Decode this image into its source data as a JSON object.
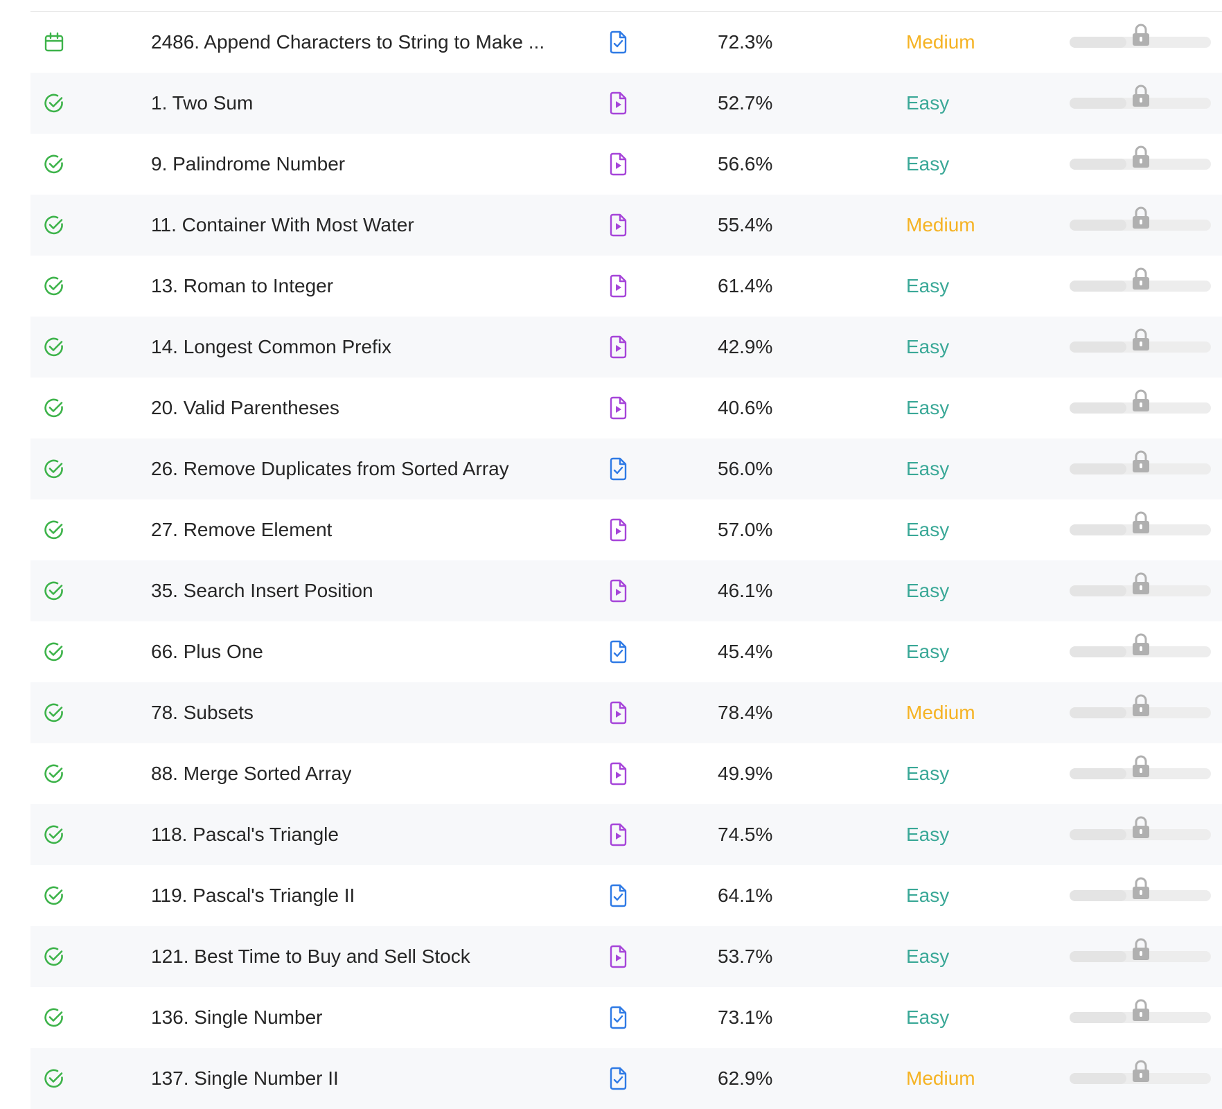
{
  "colors": {
    "easy": "#3aa897",
    "medium": "#f5b324",
    "hard": "#ef4743",
    "solved": "#3db34a",
    "daily": "#3db34a",
    "video_solution": "#a645d9",
    "article_solution": "#2f7ae5",
    "lock": "#b0b0b0"
  },
  "problems": [
    {
      "status_icon": "calendar-icon",
      "title": "2486. Append Characters to String to Make ...",
      "solution_icon": "article-solution-icon",
      "acceptance": "72.3%",
      "difficulty": "Medium",
      "frequency_locked": true,
      "frequency_fill": 0.4
    },
    {
      "status_icon": "solved-check-icon",
      "title": "1. Two Sum",
      "solution_icon": "video-solution-icon",
      "acceptance": "52.7%",
      "difficulty": "Easy",
      "frequency_locked": true,
      "frequency_fill": 0.4
    },
    {
      "status_icon": "solved-check-icon",
      "title": "9. Palindrome Number",
      "solution_icon": "video-solution-icon",
      "acceptance": "56.6%",
      "difficulty": "Easy",
      "frequency_locked": true,
      "frequency_fill": 0.4
    },
    {
      "status_icon": "solved-check-icon",
      "title": "11. Container With Most Water",
      "solution_icon": "video-solution-icon",
      "acceptance": "55.4%",
      "difficulty": "Medium",
      "frequency_locked": true,
      "frequency_fill": 0.4
    },
    {
      "status_icon": "solved-check-icon",
      "title": "13. Roman to Integer",
      "solution_icon": "video-solution-icon",
      "acceptance": "61.4%",
      "difficulty": "Easy",
      "frequency_locked": true,
      "frequency_fill": 0.4
    },
    {
      "status_icon": "solved-check-icon",
      "title": "14. Longest Common Prefix",
      "solution_icon": "video-solution-icon",
      "acceptance": "42.9%",
      "difficulty": "Easy",
      "frequency_locked": true,
      "frequency_fill": 0.4
    },
    {
      "status_icon": "solved-check-icon",
      "title": "20. Valid Parentheses",
      "solution_icon": "video-solution-icon",
      "acceptance": "40.6%",
      "difficulty": "Easy",
      "frequency_locked": true,
      "frequency_fill": 0.4
    },
    {
      "status_icon": "solved-check-icon",
      "title": "26. Remove Duplicates from Sorted Array",
      "solution_icon": "article-solution-icon",
      "acceptance": "56.0%",
      "difficulty": "Easy",
      "frequency_locked": true,
      "frequency_fill": 0.4
    },
    {
      "status_icon": "solved-check-icon",
      "title": "27. Remove Element",
      "solution_icon": "video-solution-icon",
      "acceptance": "57.0%",
      "difficulty": "Easy",
      "frequency_locked": true,
      "frequency_fill": 0.4
    },
    {
      "status_icon": "solved-check-icon",
      "title": "35. Search Insert Position",
      "solution_icon": "video-solution-icon",
      "acceptance": "46.1%",
      "difficulty": "Easy",
      "frequency_locked": true,
      "frequency_fill": 0.4
    },
    {
      "status_icon": "solved-check-icon",
      "title": "66. Plus One",
      "solution_icon": "article-solution-icon",
      "acceptance": "45.4%",
      "difficulty": "Easy",
      "frequency_locked": true,
      "frequency_fill": 0.4
    },
    {
      "status_icon": "solved-check-icon",
      "title": "78. Subsets",
      "solution_icon": "video-solution-icon",
      "acceptance": "78.4%",
      "difficulty": "Medium",
      "frequency_locked": true,
      "frequency_fill": 0.4
    },
    {
      "status_icon": "solved-check-icon",
      "title": "88. Merge Sorted Array",
      "solution_icon": "video-solution-icon",
      "acceptance": "49.9%",
      "difficulty": "Easy",
      "frequency_locked": true,
      "frequency_fill": 0.4
    },
    {
      "status_icon": "solved-check-icon",
      "title": "118. Pascal's Triangle",
      "solution_icon": "video-solution-icon",
      "acceptance": "74.5%",
      "difficulty": "Easy",
      "frequency_locked": true,
      "frequency_fill": 0.4
    },
    {
      "status_icon": "solved-check-icon",
      "title": "119. Pascal's Triangle II",
      "solution_icon": "article-solution-icon",
      "acceptance": "64.1%",
      "difficulty": "Easy",
      "frequency_locked": true,
      "frequency_fill": 0.4
    },
    {
      "status_icon": "solved-check-icon",
      "title": "121. Best Time to Buy and Sell Stock",
      "solution_icon": "video-solution-icon",
      "acceptance": "53.7%",
      "difficulty": "Easy",
      "frequency_locked": true,
      "frequency_fill": 0.4
    },
    {
      "status_icon": "solved-check-icon",
      "title": "136. Single Number",
      "solution_icon": "article-solution-icon",
      "acceptance": "73.1%",
      "difficulty": "Easy",
      "frequency_locked": true,
      "frequency_fill": 0.4
    },
    {
      "status_icon": "solved-check-icon",
      "title": "137. Single Number II",
      "solution_icon": "article-solution-icon",
      "acceptance": "62.9%",
      "difficulty": "Medium",
      "frequency_locked": true,
      "frequency_fill": 0.4
    }
  ]
}
